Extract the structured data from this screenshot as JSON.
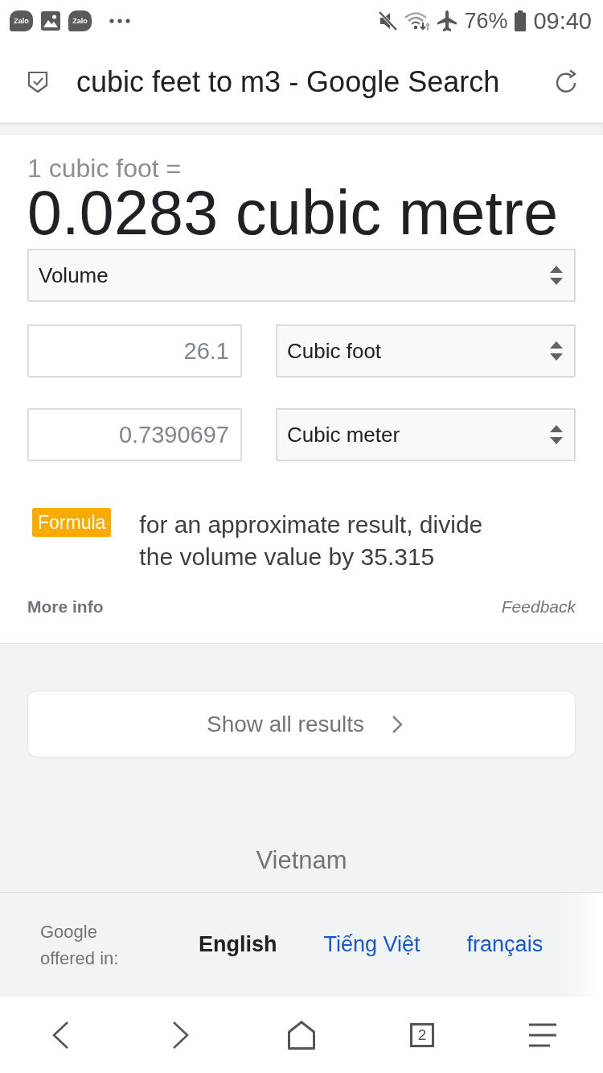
{
  "status_bar": {
    "notifications": [
      {
        "kind": "app",
        "label": "Zalo"
      },
      {
        "kind": "gallery"
      },
      {
        "kind": "app",
        "label": "Zalo"
      },
      {
        "kind": "more"
      }
    ],
    "indicators": [
      {
        "kind": "mute"
      },
      {
        "kind": "wifi"
      },
      {
        "kind": "airplane"
      }
    ],
    "battery": "76%",
    "time": "09:40"
  },
  "address_bar": {
    "title": "cubic feet to m3 - Google Search"
  },
  "converter": {
    "equation": "1 cubic foot =",
    "result": "0.0283 cubic metre",
    "quantity": "Volume",
    "rows": [
      {
        "amount": "26.1",
        "unit": "Cubic foot"
      },
      {
        "amount": "0.7390697",
        "unit": "Cubic meter"
      }
    ],
    "formula": {
      "badge": "Formula",
      "text": "for an approximate result, divide the volume value by 35.315"
    },
    "more_info": "More info",
    "feedback": "Feedback"
  },
  "show_all": {
    "label": "Show all results"
  },
  "location": "Vietnam",
  "languages": {
    "label": "Google offered in:",
    "options": [
      {
        "label": "English",
        "selected": true
      },
      {
        "label": "Tiếng Việt",
        "selected": false
      },
      {
        "label": "français",
        "selected": false
      }
    ]
  },
  "nav": {
    "tab_count": "2"
  }
}
